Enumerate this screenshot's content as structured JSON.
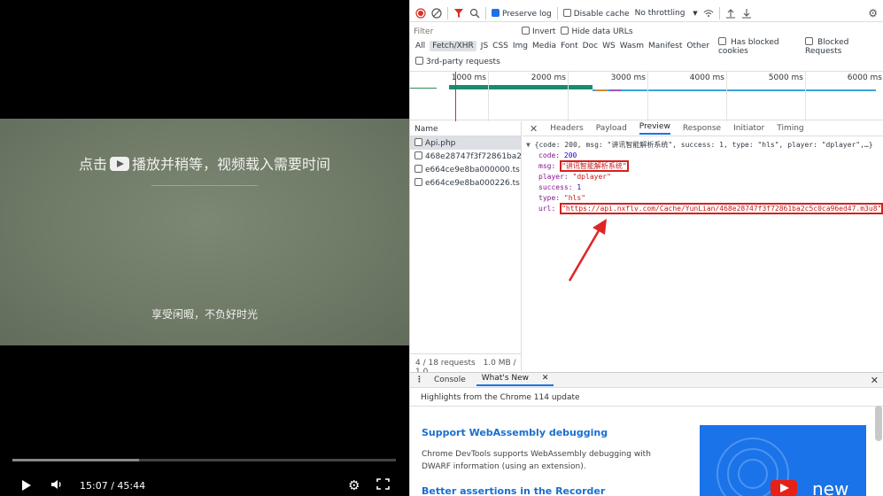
{
  "video": {
    "poster_title_a": "点击",
    "poster_title_b": "播放并稍等，视频载入需要时间",
    "poster_sub": "享受闲暇，不负好时光",
    "time": "15:07 / 45:44",
    "progress": 0.33
  },
  "devtools": {
    "toolbar": {
      "preserve_log": "Preserve log",
      "disable_cache": "Disable cache",
      "throttling": "No throttling"
    },
    "filter": {
      "placeholder": "Filter",
      "invert": "Invert",
      "hide_data_urls": "Hide data URLs"
    },
    "types": [
      "All",
      "Fetch/XHR",
      "JS",
      "CSS",
      "Img",
      "Media",
      "Font",
      "Doc",
      "WS",
      "Wasm",
      "Manifest",
      "Other"
    ],
    "selected_type": "Fetch/XHR",
    "blocked_cookies": "Has blocked cookies",
    "blocked_requests": "Blocked Requests",
    "third_party": "3rd-party requests",
    "timeline_ticks": [
      "1000 ms",
      "2000 ms",
      "3000 ms",
      "4000 ms",
      "5000 ms",
      "6000 ms"
    ],
    "list": {
      "header": "Name",
      "rows": [
        "Api.php",
        "468e28747f3f72861ba2c5...",
        "e664ce9e8ba000000.ts",
        "e664ce9e8ba000226.ts"
      ],
      "footer_count": "4 / 18 requests",
      "footer_size": "1.0 MB / 1.0"
    },
    "tabs": [
      "Headers",
      "Payload",
      "Preview",
      "Response",
      "Initiator",
      "Timing"
    ],
    "active_tab": "Preview",
    "preview": {
      "summary": "{code: 200, msg: \"讲讯智能解析系统\", success: 1, type: \"hls\", player: \"dplayer\",…}",
      "code_key": "code:",
      "code_val": "200",
      "msg_key": "msg:",
      "msg_val": "\"讲讯智能解析系统\"",
      "player_key": "player:",
      "player_val": "\"dplayer\"",
      "success_key": "success:",
      "success_val": "1",
      "type_key": "type:",
      "type_val": "\"hls\"",
      "url_key": "url:",
      "url_val": "\"https://api.nxflv.com/Cache/YunLian/468e28747f3f72861ba2c5c0ca96ed47.m3u8\""
    },
    "drawer": {
      "console": "Console",
      "whats_new": "What's New",
      "highlights": "Highlights from the Chrome 114 update",
      "item1_title": "Support WebAssembly debugging",
      "item1_desc": "Chrome DevTools supports WebAssembly debugging with DWARF information (using an extension).",
      "item2_title": "Better assertions in the Recorder",
      "thumb_text": "new"
    }
  }
}
